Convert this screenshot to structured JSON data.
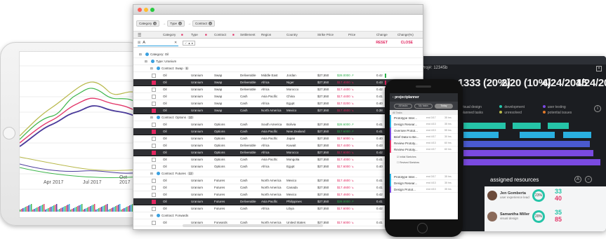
{
  "tablet": {
    "x_ticks": [
      "Apr 2017",
      "Jul 2017",
      "Oct 2017"
    ],
    "colors": {
      "green": "#3cb54a",
      "red": "#e3396b",
      "purple": "#4a3a9a",
      "olive": "#b8b84a"
    }
  },
  "grid": {
    "group_chips": [
      "Category",
      "Type",
      "Contract"
    ],
    "columns": [
      "Category",
      "Type",
      "Contract",
      "Settlement",
      "Region",
      "Country",
      "Strike Price",
      "Price",
      "Change",
      "Change(%)"
    ],
    "search_value": "A",
    "reset_label": "RESET",
    "close_label": "CLOSE",
    "rows": [
      {
        "kind": "group",
        "label": "Category: Oil",
        "count": "",
        "level": 0
      },
      {
        "kind": "group",
        "label": "Type: Uranium",
        "count": "",
        "level": 1
      },
      {
        "kind": "group",
        "label": "Contract: Swap",
        "count": "6",
        "level": 2
      },
      {
        "kind": "data",
        "sel": false,
        "c": [
          "Oil",
          "Uranium",
          "Swap",
          "Deliverable",
          "Middle East",
          "Jordan",
          "$27,550",
          "$28.0000 ↗",
          "0.42"
        ],
        "up": true
      },
      {
        "kind": "data",
        "sel": true,
        "c": [
          "Oil",
          "Uranium",
          "Swap",
          "Deliverable",
          "Africa",
          "Niger",
          "$27,550",
          "$17.4000 ↘",
          "0.43"
        ],
        "up": false
      },
      {
        "kind": "data",
        "sel": false,
        "c": [
          "Oil",
          "Uranium",
          "Swap",
          "Deliverable",
          "Africa",
          "Morocco",
          "$27,550",
          "$17.4400 ↘",
          "0.42"
        ],
        "up": false
      },
      {
        "kind": "data",
        "sel": false,
        "c": [
          "Oil",
          "Uranium",
          "Swap",
          "Cash",
          "Asia Pacific",
          "China",
          "$27,550",
          "$17.4400 ↘",
          "0.41"
        ],
        "up": false
      },
      {
        "kind": "data",
        "sel": false,
        "c": [
          "Oil",
          "Uranium",
          "Swap",
          "Cash",
          "Africa",
          "Egypt",
          "$27,550",
          "$17.0200 ↘",
          "0.40"
        ],
        "up": false
      },
      {
        "kind": "data",
        "sel": true,
        "c": [
          "Oil",
          "Uranium",
          "Swap",
          "Cash",
          "North America",
          "Mexico",
          "$27,550",
          "$17.4600 ↘",
          "0.38"
        ],
        "up": false
      },
      {
        "kind": "group",
        "label": "Contract: Options",
        "count": "10",
        "level": 2
      },
      {
        "kind": "data",
        "sel": false,
        "c": [
          "Oil",
          "Uranium",
          "Options",
          "Cash",
          "South America",
          "Bolivia",
          "$27,550",
          "$28.6000 ↗",
          "0.41"
        ],
        "up": true
      },
      {
        "kind": "data",
        "sel": true,
        "c": [
          "Oil",
          "Uranium",
          "Options",
          "Cash",
          "Asia Pacific",
          "New Zealand",
          "$27,550",
          "$17.6000 ↗",
          "0.41"
        ],
        "up": true
      },
      {
        "kind": "data",
        "sel": false,
        "c": [
          "Oil",
          "Uranium",
          "Options",
          "Cash",
          "Asia Pacific",
          "Japan",
          "$27,550",
          "$17.6000 ↘",
          "0.40"
        ],
        "up": false
      },
      {
        "kind": "data",
        "sel": false,
        "c": [
          "Oil",
          "Uranium",
          "Options",
          "Deliverable",
          "Africa",
          "Kuwait",
          "$27,550",
          "$17.4400 ↘",
          "0.43"
        ],
        "up": false
      },
      {
        "kind": "data",
        "sel": true,
        "c": [
          "Oil",
          "Uranium",
          "Options",
          "Deliverable",
          "Africa",
          "Morocco",
          "$27,550",
          "$17.6000 ↘",
          "0.42"
        ],
        "up": false
      },
      {
        "kind": "data",
        "sel": false,
        "c": [
          "Oil",
          "Uranium",
          "Options",
          "Cash",
          "Asia Pacific",
          "Mongolia",
          "$27,550",
          "$17.4000 ↘",
          "0.41"
        ],
        "up": false
      },
      {
        "kind": "data",
        "sel": false,
        "c": [
          "Oil",
          "Uranium",
          "Options",
          "Cash",
          "Africa",
          "Egypt",
          "$27,550",
          "$17.6000 ↘",
          "0.40"
        ],
        "up": false
      },
      {
        "kind": "group",
        "label": "Contract: Futures",
        "count": "12",
        "level": 2
      },
      {
        "kind": "data",
        "sel": false,
        "c": [
          "Oil",
          "Uranium",
          "Futures",
          "Cash",
          "North America",
          "Mexico",
          "$27,550",
          "$17.4600 ↘",
          "0.41"
        ],
        "up": false
      },
      {
        "kind": "data",
        "sel": false,
        "c": [
          "Oil",
          "Uranium",
          "Futures",
          "Cash",
          "North America",
          "Canada",
          "$27,550",
          "$17.4600 ↘",
          "0.41"
        ],
        "up": false
      },
      {
        "kind": "data",
        "sel": false,
        "c": [
          "Oil",
          "Uranium",
          "Futures",
          "Cash",
          "North America",
          "Mexico",
          "$27,550",
          "$17.4600 ↘",
          "0.42"
        ],
        "up": false
      },
      {
        "kind": "data",
        "sel": true,
        "c": [
          "Oil",
          "Uranium",
          "Futures",
          "Deliverable",
          "Asia Pacific",
          "Philippines",
          "$27,550",
          "$28.0000 ↗",
          "0.41"
        ],
        "up": true
      },
      {
        "kind": "data",
        "sel": false,
        "c": [
          "Oil",
          "Uranium",
          "Futures",
          "Cash",
          "Africa",
          "Libya",
          "$27,550",
          "$17.6000 ↘",
          "0.42"
        ],
        "up": false
      },
      {
        "kind": "group",
        "label": "Contract: Forwards",
        "count": "",
        "level": 2
      },
      {
        "kind": "data",
        "sel": false,
        "c": [
          "Oil",
          "Uranium",
          "Forwards",
          "Cash",
          "North America",
          "United States",
          "$27,550",
          "$17.6000 ↘",
          "0.41"
        ],
        "up": false
      }
    ]
  },
  "phone": {
    "app_title": "projectplanner",
    "tabs": [
      "All tasks",
      "My tasks",
      "Today"
    ],
    "list_header": "All Tasks",
    "items": [
      {
        "title": "Prototype Inter...",
        "date": "end 3/17",
        "hours": "35 hrs",
        "color": "#2ab0e0"
      },
      {
        "title": "Design Resear...",
        "date": "end 4/13",
        "hours": "35 hrs",
        "color": "#2ab0e0"
      },
      {
        "title": "Oversee Protot...",
        "date": "end 4/13",
        "hours": "55 hrs",
        "color": "#7a4ae0"
      },
      {
        "title": "Brief Data to Be...",
        "date": "end 4/17",
        "hours": "30 hrs",
        "color": "#7a4ae0"
      },
      {
        "title": "Review Prototy...",
        "date": "end 4/13",
        "hours": "60 hrs",
        "color": "#e3396b"
      },
      {
        "title": "Review Prototy...",
        "date": "end 4/17",
        "hours": "60 hrs",
        "color": "#e3396b"
      }
    ],
    "expanded": [
      "Initial Sketches",
      "Revised Sketches"
    ],
    "bottom_items": [
      {
        "title": "Prototype Inter...",
        "date": "end 3/17",
        "hours": "35 hrs",
        "color": "#2ab0e0"
      },
      {
        "title": "Design Resear...",
        "date": "end 4/13",
        "hours": "35 hrs",
        "color": "#2ab0e0"
      },
      {
        "title": "Design Protot...",
        "date": "end 4/13",
        "hours": "35 hrs",
        "color": "#7a4ae0"
      }
    ]
  },
  "dashboard": {
    "project": "Proj#: 12345b",
    "stats": [
      {
        "label": "",
        "value": "1333 (20%)"
      },
      {
        "label": "",
        "value": "2/20 (10%)"
      },
      {
        "label": "",
        "value": "4/24/2015"
      },
      {
        "label": "",
        "value": "4/24/2015"
      }
    ],
    "legend": [
      {
        "label": "visual design",
        "color": "#2ab0e0"
      },
      {
        "label": "development",
        "color": "#25c4a8"
      },
      {
        "label": "user testing",
        "color": "#7a4ae0"
      },
      {
        "label": "planned tasks",
        "color": "#e3396b"
      },
      {
        "label": "unresolved",
        "color": "#b8b84a"
      },
      {
        "label": "potential issues",
        "color": "#e07a2a"
      }
    ],
    "assigned_title": "assigned resources",
    "resources": [
      {
        "name": "Jen Gomberta",
        "role": "user experience lead",
        "pct": "23%",
        "num_a": "33",
        "num_b": "40"
      },
      {
        "name": "Samantha Miller",
        "role": "visual design",
        "pct": "20%",
        "num_a": "35",
        "num_b": "85"
      }
    ]
  }
}
